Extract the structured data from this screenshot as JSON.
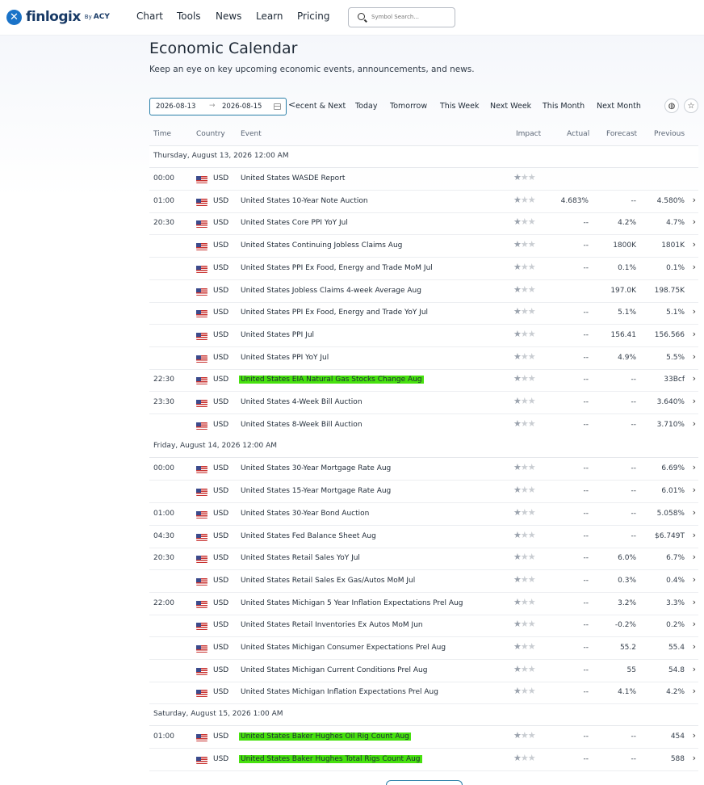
{
  "header": {
    "logo_mark": "✕",
    "logo_text": "finlogix",
    "logo_by": "By",
    "logo_brand": "ACY",
    "nav": [
      "Chart",
      "Tools",
      "News",
      "Learn",
      "Pricing"
    ],
    "search_placeholder": "Symbol Search..."
  },
  "page": {
    "title": "Economic Calendar",
    "subtitle": "Keep an eye on key upcoming economic events, announcements, and news."
  },
  "filters": {
    "date_from": "2026-08-13",
    "date_to": "2026-08-15",
    "quick": [
      "<",
      "ecent & Next",
      "Today",
      "Tomorrow",
      "This Week",
      "Next Week",
      "This Month",
      "Next Month"
    ]
  },
  "columns": {
    "time": "Time",
    "country": "Country",
    "event": "Event",
    "impact": "Impact",
    "actual": "Actual",
    "forecast": "Forecast",
    "previous": "Previous"
  },
  "groups": [
    {
      "label": "Thursday, August 13, 2026 12:00 AM",
      "rows": [
        {
          "time": "00:00",
          "currency": "USD",
          "event": "United States WASDE Report",
          "impact": 1,
          "actual": "",
          "forecast": "",
          "previous": "",
          "highlight": false,
          "chevron": false
        },
        {
          "time": "01:00",
          "currency": "USD",
          "event": "United States 10-Year Note Auction",
          "impact": 1,
          "actual": "4.683%",
          "forecast": "--",
          "previous": "4.580%",
          "highlight": false,
          "chevron": true
        },
        {
          "time": "20:30",
          "currency": "USD",
          "event": "United States Core PPI YoY Jul",
          "impact": 1,
          "actual": "--",
          "forecast": "4.2%",
          "previous": "4.7%",
          "highlight": false,
          "chevron": true
        },
        {
          "time": "",
          "currency": "USD",
          "event": "United States Continuing Jobless Claims Aug",
          "impact": 1,
          "actual": "--",
          "forecast": "1800K",
          "previous": "1801K",
          "highlight": false,
          "chevron": true
        },
        {
          "time": "",
          "currency": "USD",
          "event": "United States PPI Ex Food, Energy and Trade MoM Jul",
          "impact": 1,
          "actual": "--",
          "forecast": "0.1%",
          "previous": "0.1%",
          "highlight": false,
          "chevron": true
        },
        {
          "time": "",
          "currency": "USD",
          "event": "United States Jobless Claims 4-week Average Aug",
          "impact": 1,
          "actual": "",
          "forecast": "197.0K",
          "previous": "198.75K",
          "highlight": false,
          "chevron": false
        },
        {
          "time": "",
          "currency": "USD",
          "event": "United States PPI Ex Food, Energy and Trade YoY Jul",
          "impact": 1,
          "actual": "--",
          "forecast": "5.1%",
          "previous": "5.1%",
          "highlight": false,
          "chevron": true
        },
        {
          "time": "",
          "currency": "USD",
          "event": "United States PPI Jul",
          "impact": 1,
          "actual": "--",
          "forecast": "156.41",
          "previous": "156.566",
          "highlight": false,
          "chevron": true
        },
        {
          "time": "",
          "currency": "USD",
          "event": "United States PPI YoY Jul",
          "impact": 1,
          "actual": "--",
          "forecast": "4.9%",
          "previous": "5.5%",
          "highlight": false,
          "chevron": true
        },
        {
          "time": "22:30",
          "currency": "USD",
          "event": "United States EIA Natural Gas Stocks Change Aug",
          "impact": 1,
          "actual": "--",
          "forecast": "--",
          "previous": "33Bcf",
          "highlight": true,
          "chevron": true
        },
        {
          "time": "23:30",
          "currency": "USD",
          "event": "United States 4-Week Bill Auction",
          "impact": 1,
          "actual": "--",
          "forecast": "--",
          "previous": "3.640%",
          "highlight": false,
          "chevron": true
        },
        {
          "time": "",
          "currency": "USD",
          "event": "United States 8-Week Bill Auction",
          "impact": 1,
          "actual": "--",
          "forecast": "--",
          "previous": "3.710%",
          "highlight": false,
          "chevron": true
        }
      ]
    },
    {
      "label": "Friday, August 14, 2026 12:00 AM",
      "rows": [
        {
          "time": "00:00",
          "currency": "USD",
          "event": "United States 30-Year Mortgage Rate Aug",
          "impact": 1,
          "actual": "--",
          "forecast": "--",
          "previous": "6.69%",
          "highlight": false,
          "chevron": true
        },
        {
          "time": "",
          "currency": "USD",
          "event": "United States 15-Year Mortgage Rate Aug",
          "impact": 1,
          "actual": "--",
          "forecast": "--",
          "previous": "6.01%",
          "highlight": false,
          "chevron": true
        },
        {
          "time": "01:00",
          "currency": "USD",
          "event": "United States 30-Year Bond Auction",
          "impact": 1,
          "actual": "--",
          "forecast": "--",
          "previous": "5.058%",
          "highlight": false,
          "chevron": true
        },
        {
          "time": "04:30",
          "currency": "USD",
          "event": "United States Fed Balance Sheet Aug",
          "impact": 1,
          "actual": "--",
          "forecast": "--",
          "previous": "$6.749T",
          "highlight": false,
          "chevron": true
        },
        {
          "time": "20:30",
          "currency": "USD",
          "event": "United States Retail Sales YoY Jul",
          "impact": 1,
          "actual": "--",
          "forecast": "6.0%",
          "previous": "6.7%",
          "highlight": false,
          "chevron": true
        },
        {
          "time": "",
          "currency": "USD",
          "event": "United States Retail Sales Ex Gas/Autos MoM Jul",
          "impact": 1,
          "actual": "--",
          "forecast": "0.3%",
          "previous": "0.4%",
          "highlight": false,
          "chevron": true
        },
        {
          "time": "22:00",
          "currency": "USD",
          "event": "United States Michigan 5 Year Inflation Expectations Prel Aug",
          "impact": 1,
          "actual": "--",
          "forecast": "3.2%",
          "previous": "3.3%",
          "highlight": false,
          "chevron": true
        },
        {
          "time": "",
          "currency": "USD",
          "event": "United States Retail Inventories Ex Autos MoM Jun",
          "impact": 1,
          "actual": "--",
          "forecast": "-0.2%",
          "previous": "0.2%",
          "highlight": false,
          "chevron": true
        },
        {
          "time": "",
          "currency": "USD",
          "event": "United States Michigan Consumer Expectations Prel Aug",
          "impact": 1,
          "actual": "--",
          "forecast": "55.2",
          "previous": "55.4",
          "highlight": false,
          "chevron": true
        },
        {
          "time": "",
          "currency": "USD",
          "event": "United States Michigan Current Conditions Prel Aug",
          "impact": 1,
          "actual": "--",
          "forecast": "55",
          "previous": "54.8",
          "highlight": false,
          "chevron": true
        },
        {
          "time": "",
          "currency": "USD",
          "event": "United States Michigan Inflation Expectations Prel Aug",
          "impact": 1,
          "actual": "--",
          "forecast": "4.1%",
          "previous": "4.2%",
          "highlight": false,
          "chevron": true
        }
      ]
    },
    {
      "label": "Saturday, August 15, 2026 1:00 AM",
      "rows": [
        {
          "time": "01:00",
          "currency": "USD",
          "event": "United States Baker Hughes Oil Rig Count Aug",
          "impact": 1,
          "actual": "--",
          "forecast": "--",
          "previous": "454",
          "highlight": true,
          "chevron": true
        },
        {
          "time": "",
          "currency": "USD",
          "event": "United States Baker Hughes Total Rigs Count Aug",
          "impact": 1,
          "actual": "--",
          "forecast": "--",
          "previous": "588",
          "highlight": true,
          "chevron": true
        }
      ]
    }
  ],
  "colors": {
    "accent": "#2a7fa8",
    "highlight": "#47e10e",
    "logo": "#1a73c8"
  }
}
